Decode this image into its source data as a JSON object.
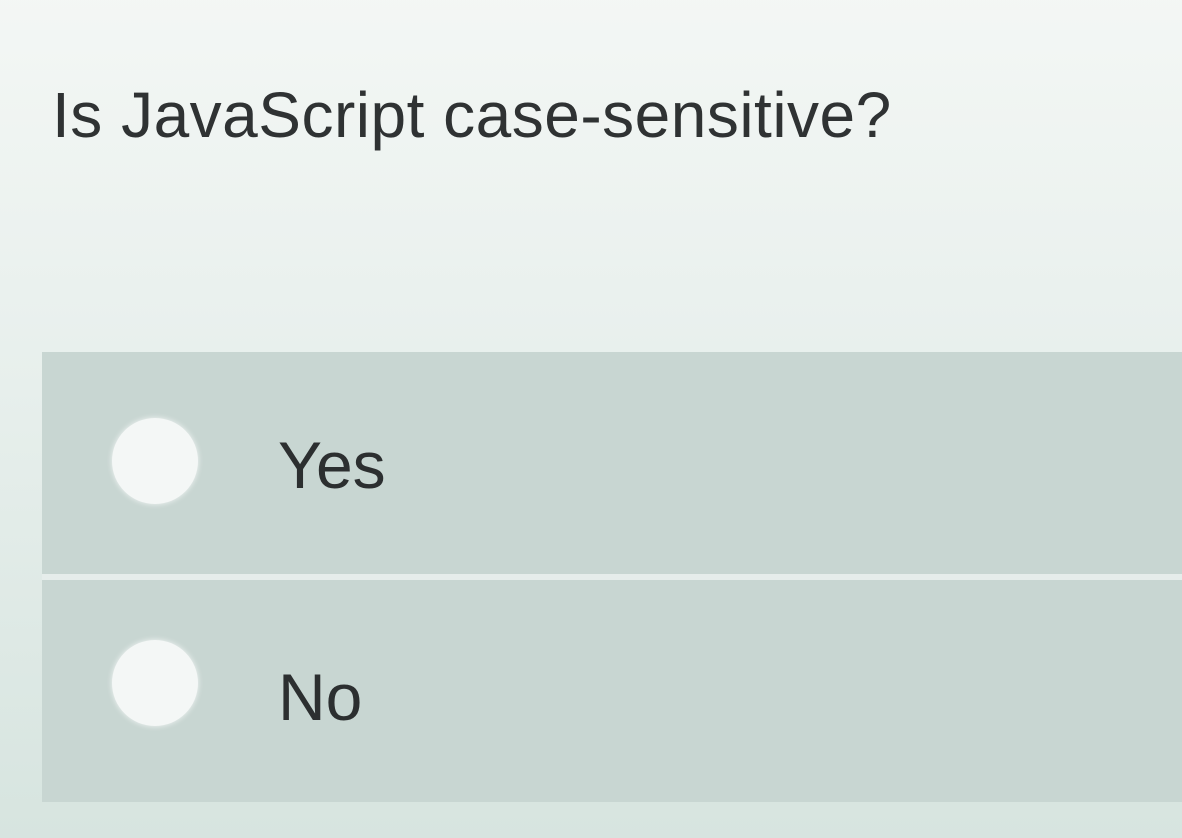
{
  "question": {
    "text": "Is JavaScript case-sensitive?"
  },
  "options": [
    {
      "label": "Yes",
      "selected": false
    },
    {
      "label": "No",
      "selected": false
    }
  ],
  "colors": {
    "background": "#e4ebe8",
    "option_background": "#c8d6d2",
    "radio": "#f4f7f6",
    "text": "#2f3233"
  }
}
